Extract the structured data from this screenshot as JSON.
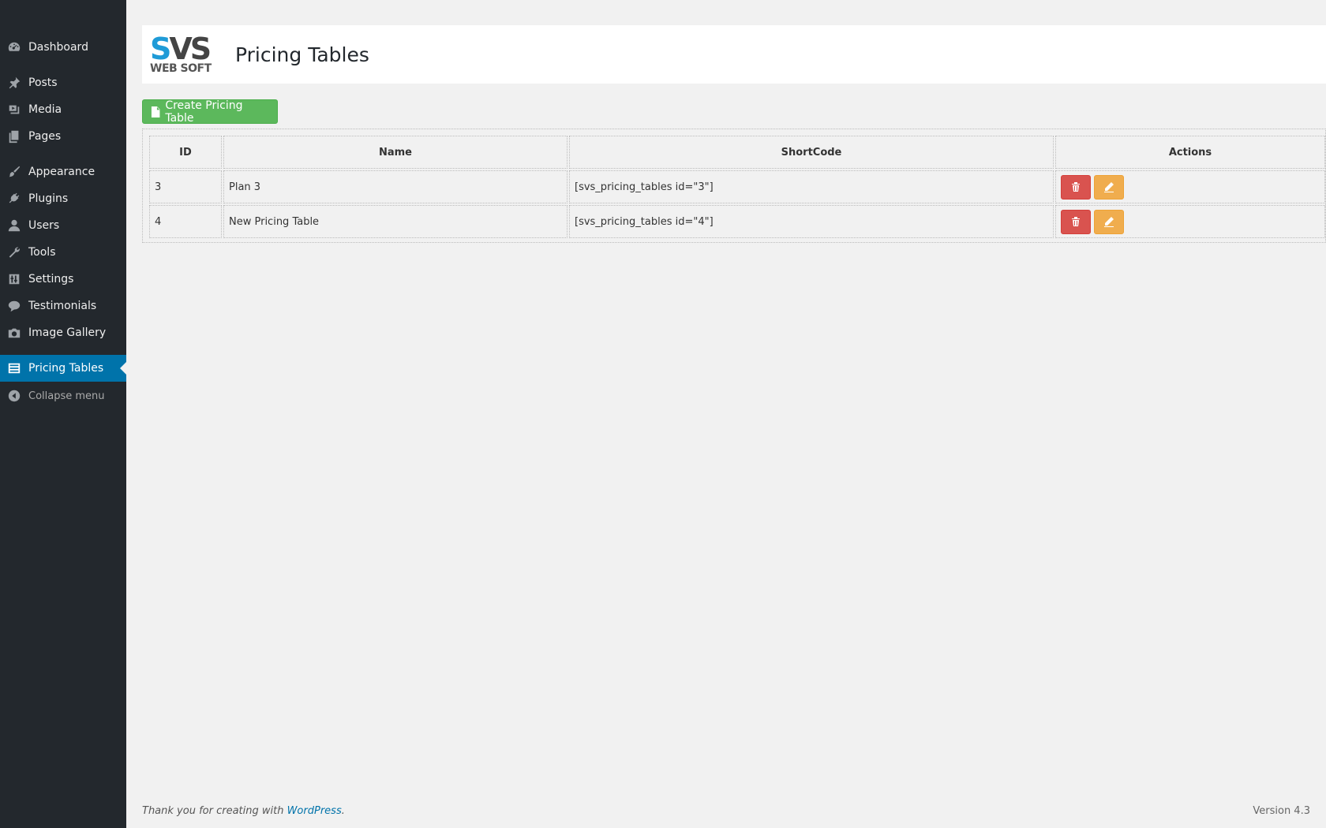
{
  "sidebar": {
    "items": [
      {
        "label": "Dashboard",
        "icon": "dashboard-icon"
      },
      {
        "label": "Posts",
        "icon": "pin-icon"
      },
      {
        "label": "Media",
        "icon": "media-icon"
      },
      {
        "label": "Pages",
        "icon": "pages-icon"
      },
      {
        "label": "Appearance",
        "icon": "paintbrush-icon"
      },
      {
        "label": "Plugins",
        "icon": "plug-icon"
      },
      {
        "label": "Users",
        "icon": "user-icon"
      },
      {
        "label": "Tools",
        "icon": "wrench-icon"
      },
      {
        "label": "Settings",
        "icon": "sliders-icon"
      },
      {
        "label": "Testimonials",
        "icon": "speech-bubble-icon"
      },
      {
        "label": "Image Gallery",
        "icon": "camera-icon"
      },
      {
        "label": "Pricing Tables",
        "icon": "list-table-icon",
        "active": true
      }
    ],
    "collapse_label": "Collapse menu"
  },
  "header": {
    "logo_top": "SVS",
    "logo_bottom": "WEB SOFT",
    "title": "Pricing Tables"
  },
  "toolbar": {
    "create_label": "Create Pricing Table"
  },
  "table": {
    "columns": [
      "ID",
      "Name",
      "ShortCode",
      "Actions"
    ],
    "rows": [
      {
        "id": "3",
        "name": "Plan 3",
        "shortcode": "[svs_pricing_tables id=\"3\"]"
      },
      {
        "id": "4",
        "name": "New Pricing Table",
        "shortcode": "[svs_pricing_tables id=\"4\"]"
      }
    ]
  },
  "footer": {
    "thanks_prefix": "Thank you for creating with ",
    "thanks_link": "WordPress",
    "thanks_suffix": ".",
    "version": "Version 4.3"
  },
  "colors": {
    "sidebar_bg": "#23282d",
    "active_bg": "#0073aa",
    "create_btn": "#5cb85c",
    "delete_btn": "#d9534f",
    "edit_btn": "#f0ad4e"
  }
}
